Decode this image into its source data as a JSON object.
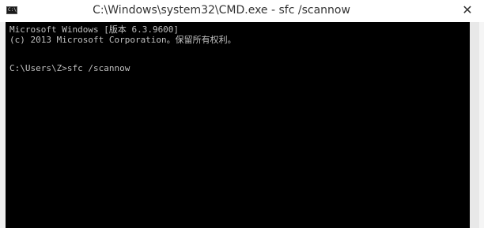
{
  "window": {
    "title": "C:\\Windows\\system32\\CMD.exe - sfc  /scannow",
    "icon_label": "C:\\",
    "close_glyph": "✕"
  },
  "console": {
    "lines": [
      "Microsoft Windows [版本 6.3.9600]",
      "(c) 2013 Microsoft Corporation。保留所有权利。",
      "",
      "C:\\Users\\Z>sfc /scannow"
    ]
  },
  "colors": {
    "console_bg": "#000000",
    "console_text": "#c0c0c0",
    "titlebar_bg": "#ffffff"
  }
}
